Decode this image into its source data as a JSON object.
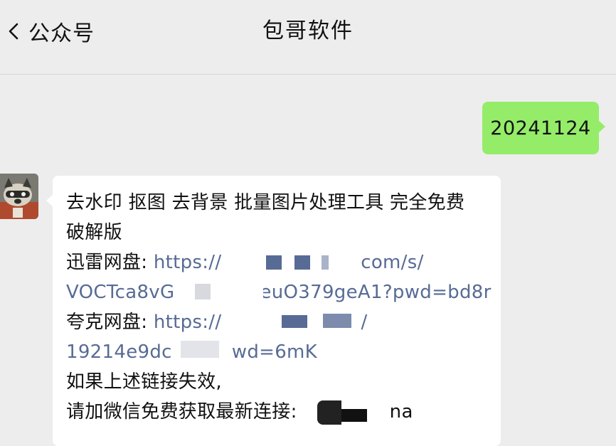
{
  "header": {
    "back_label": "公众号",
    "title": "包哥软件"
  },
  "messages": {
    "outgoing": {
      "text": "20241124"
    },
    "incoming": {
      "line1": "去水印 抠图 去背景 批量图片处理工具 完全免费",
      "line2": "破解版",
      "xunlei_label": "迅雷网盘: ",
      "xunlei_link_start": "https://pan",
      "xunlei_link_end": "com/s/",
      "xunlei_link_line2_start": "VOCTca8vG",
      "xunlei_link_line2_end": "euO379geA1?pwd=bd8r",
      "quark_label": "夸克网盘: ",
      "quark_link_start": "https://",
      "quark_link_end": "/",
      "quark_link_line2_start": "19214e9dc",
      "quark_link_line2_end": "wd=6mK",
      "fallback_line1": "如果上述链接失效,",
      "fallback_line2": "请加微信免费获取最新连接:",
      "wechat_id_tail": "na"
    }
  },
  "colors": {
    "background": "#ededed",
    "outgoing_bubble": "#95ec69",
    "incoming_bubble": "#ffffff",
    "link": "#576b95"
  }
}
